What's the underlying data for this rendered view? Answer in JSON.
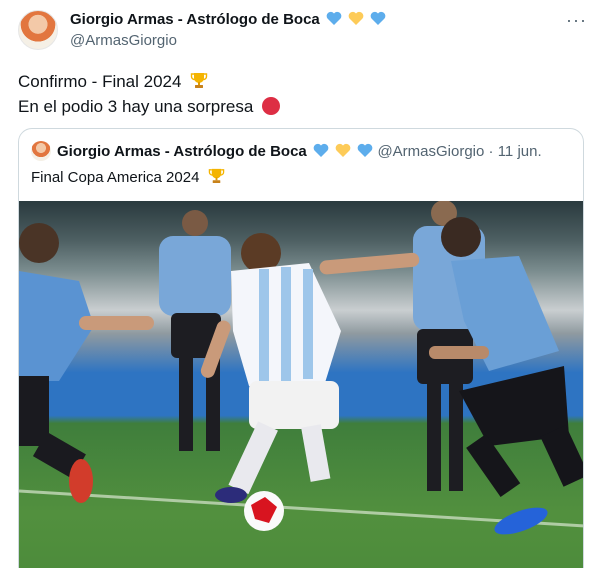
{
  "tweet": {
    "author_name": "Giorgio Armas - Astrólogo de Boca",
    "author_emojis": [
      "blue-heart",
      "yellow-heart",
      "blue-heart"
    ],
    "handle": "@ArmasGiorgio",
    "more_label": "···",
    "lines": [
      "Confirmo - Final 2024",
      "En el podio 3 hay una sorpresa"
    ]
  },
  "quoted_tweet": {
    "author_name": "Giorgio Armas - Astrólogo de Boca",
    "handle": "@ArmasGiorgio",
    "separator": " · ",
    "date": "11 jun.",
    "text": "Final Copa America 2024"
  },
  "colors": {
    "blue_heart": "#5dadec",
    "yellow_heart": "#fdcb58",
    "red_circle": "#dd2e44",
    "handle_gray": "#536471"
  },
  "icons": {
    "more": "more-dots-icon",
    "trophy": "trophy-icon",
    "red_circle": "red-circle-icon"
  }
}
